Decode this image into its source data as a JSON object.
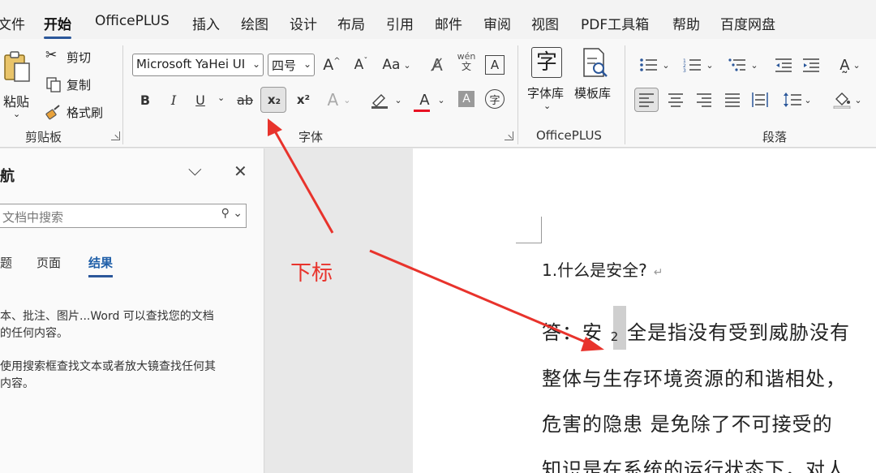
{
  "menu": {
    "tabs": [
      {
        "label": "文件"
      },
      {
        "label": "开始"
      },
      {
        "label": "OfficePLUS"
      },
      {
        "label": "插入"
      },
      {
        "label": "绘图"
      },
      {
        "label": "设计"
      },
      {
        "label": "布局"
      },
      {
        "label": "引用"
      },
      {
        "label": "邮件"
      },
      {
        "label": "审阅"
      },
      {
        "label": "视图"
      },
      {
        "label": "PDF工具箱"
      },
      {
        "label": "帮助"
      },
      {
        "label": "百度网盘"
      }
    ],
    "active_tab": "开始"
  },
  "ribbon": {
    "clipboard": {
      "paste": "粘贴",
      "cut": "剪切",
      "copy": "复制",
      "format_painter": "格式刷",
      "group_label": "剪贴板"
    },
    "font": {
      "font_name": "Microsoft YaHei UI",
      "font_size": "四号",
      "bold": "B",
      "italic": "I",
      "underline": "U",
      "strikethrough": "ab",
      "subscript": "x₂",
      "superscript": "x²",
      "change_case": "Aa",
      "phonetic_top": "wén",
      "phonetic_bottom": "文",
      "char_border": "A",
      "font_color": "A",
      "char_shading": "A",
      "enclose": "字",
      "grow": "A",
      "shrink": "A",
      "group_label": "字体"
    },
    "officeplus": {
      "font_library": "字体库",
      "template_library": "模板库",
      "font_library_glyph": "字",
      "group_label": "OfficePLUS"
    },
    "paragraph": {
      "group_label": "段落"
    }
  },
  "nav": {
    "title": "航",
    "search_placeholder": "文档中搜索",
    "tabs": [
      {
        "label": "题"
      },
      {
        "label": "页面"
      },
      {
        "label": "结果"
      }
    ],
    "active_tab": "结果",
    "help_1_line1": "本、批注、图片...Word 可以查找您的文档",
    "help_1_line2": "的任何内容。",
    "help_2_line1": "使用搜索框查找文本或者放大镜查找任何其",
    "help_2_line2": "内容。"
  },
  "annotation": {
    "text": "下标",
    "color": "#e8332c"
  },
  "document": {
    "heading": "1.什么是安全?",
    "paragraph_mark": "↵",
    "line1_before": "答：安",
    "line1_sub": "2",
    "line1_after": "全是指没有受到威胁没有",
    "line2": "整体与生存环境资源的和谐相处，",
    "line3": "危害的隐患  是免除了不可接受的",
    "line4": "知识是在系统的运行状态下，对人"
  },
  "colors": {
    "accent": "#2b579a",
    "annotation_red": "#e8332c",
    "font_color_bar": "#e81123"
  }
}
